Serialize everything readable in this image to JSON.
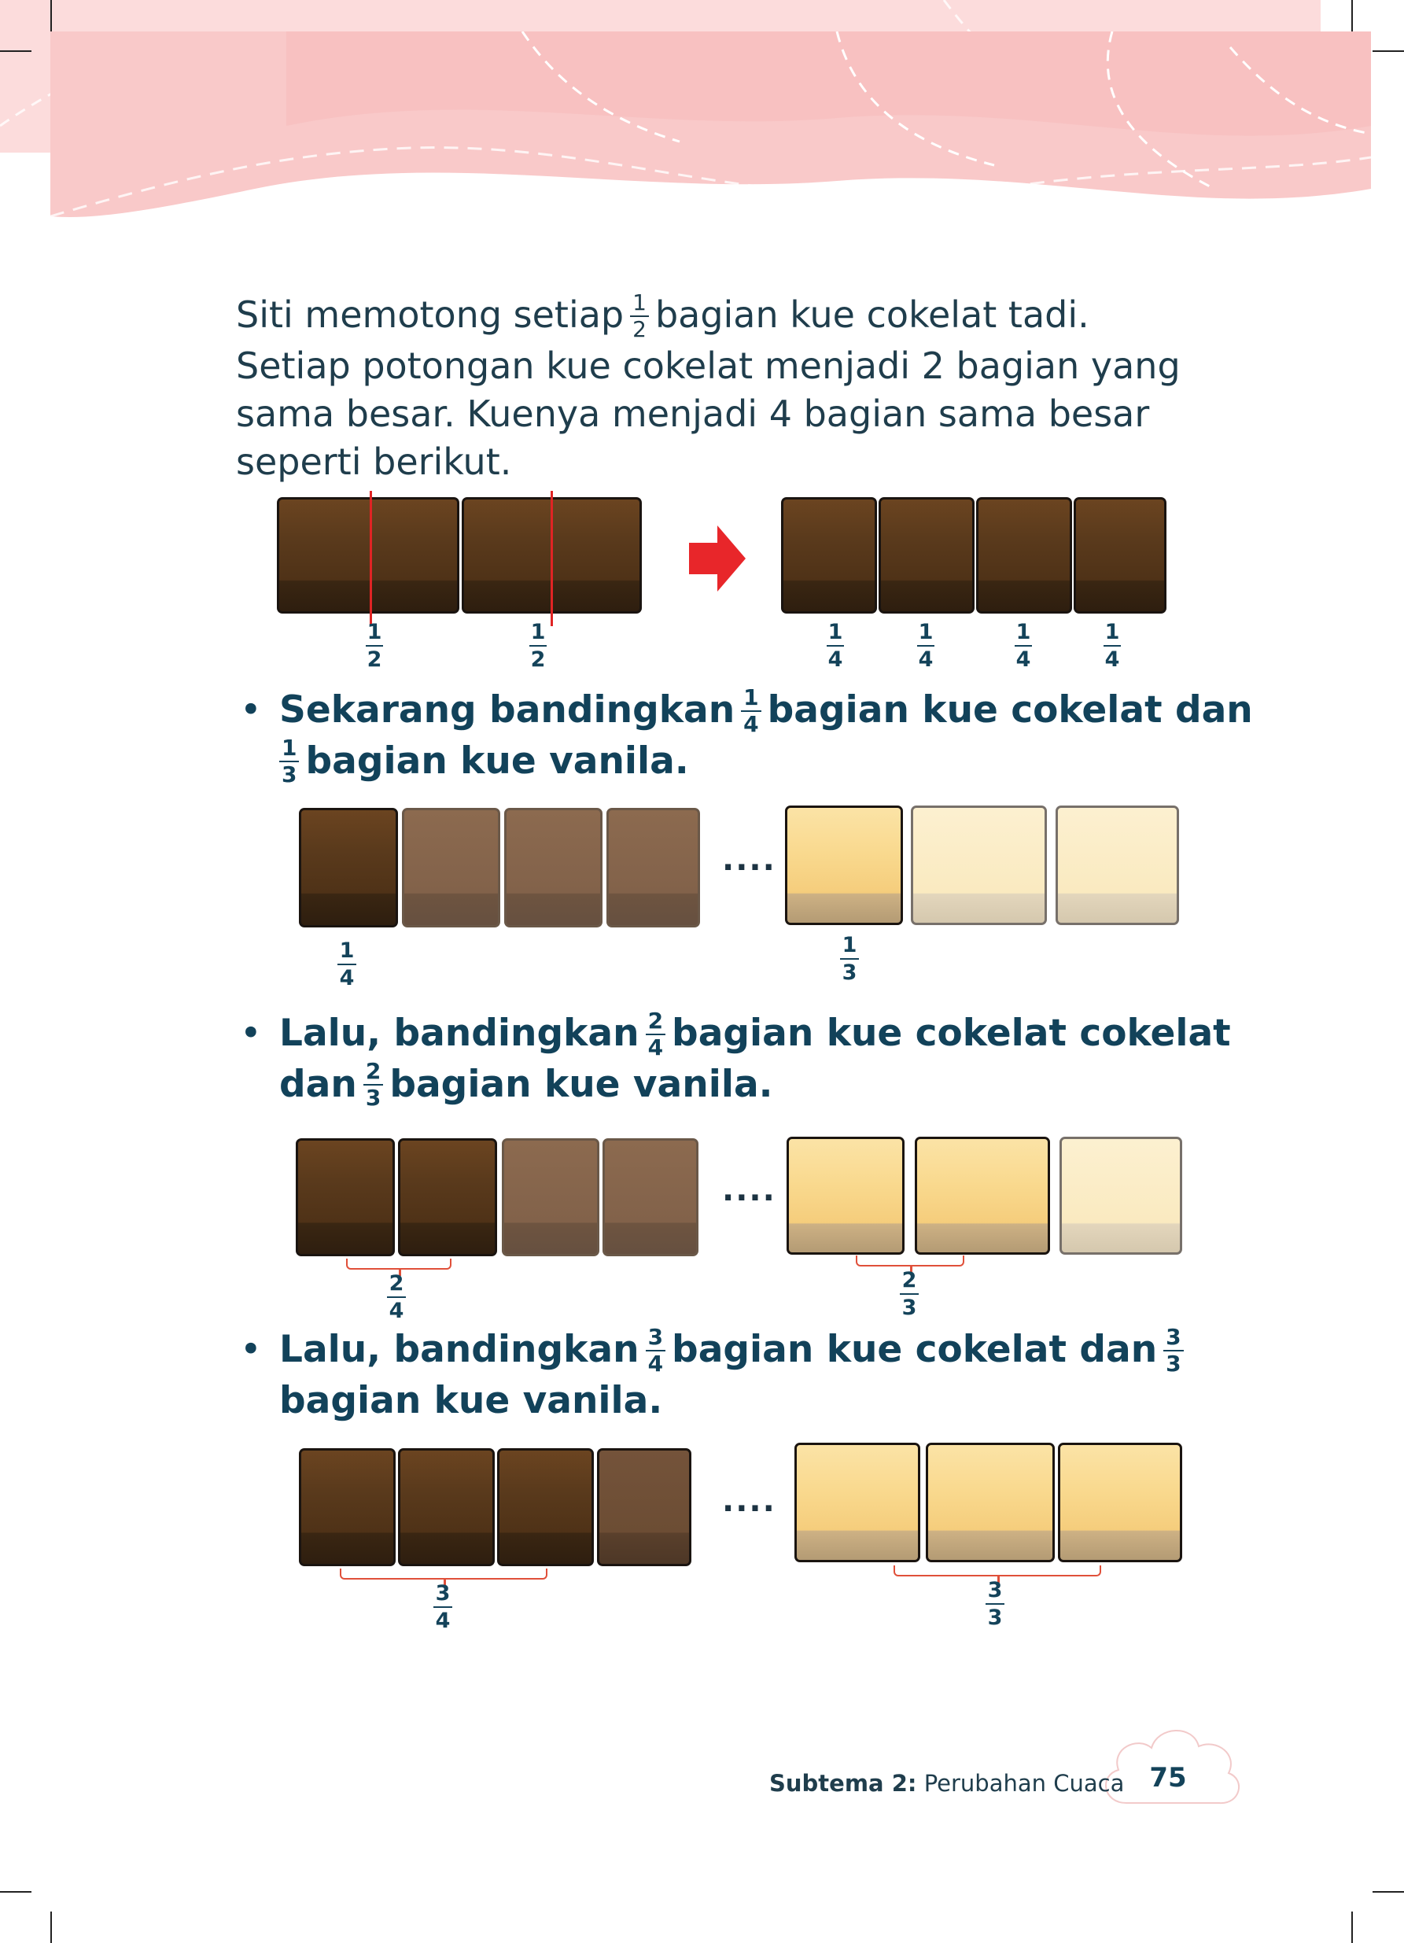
{
  "intro": {
    "line1_pre": "Siti memotong setiap",
    "line1_frac_n": "1",
    "line1_frac_d": "2",
    "line1_post": "bagian kue cokelat tadi.",
    "line2": "Setiap potongan kue cokelat menjadi 2 bagian yang",
    "line3": "sama besar. Kuenya menjadi 4 bagian sama besar",
    "line4": "seperti berikut."
  },
  "figure1": {
    "left_labels": [
      {
        "n": "1",
        "d": "2"
      },
      {
        "n": "1",
        "d": "2"
      }
    ],
    "right_labels": [
      {
        "n": "1",
        "d": "4"
      },
      {
        "n": "1",
        "d": "4"
      },
      {
        "n": "1",
        "d": "4"
      },
      {
        "n": "1",
        "d": "4"
      }
    ],
    "arrow_color": "#e8262a"
  },
  "bullets": [
    {
      "pre": "Sekarang bandingkan",
      "frac1": {
        "n": "1",
        "d": "4"
      },
      "mid": "bagian kue cokelat dan",
      "frac2": {
        "n": "1",
        "d": "3"
      },
      "post": "bagian kue vanila.",
      "choc_label": {
        "n": "1",
        "d": "4"
      },
      "van_label": {
        "n": "1",
        "d": "3"
      },
      "compare": "...."
    },
    {
      "pre": "Lalu, bandingkan",
      "frac1": {
        "n": "2",
        "d": "4"
      },
      "mid": "bagian kue cokelat cokelat",
      "line2_pre": "dan",
      "frac2": {
        "n": "2",
        "d": "3"
      },
      "post": "bagian kue vanila.",
      "choc_label": {
        "n": "2",
        "d": "4"
      },
      "van_label": {
        "n": "2",
        "d": "3"
      },
      "compare": "...."
    },
    {
      "pre": "Lalu, bandingkan",
      "frac1": {
        "n": "3",
        "d": "4"
      },
      "mid": "bagian kue cokelat dan",
      "frac2": {
        "n": "3",
        "d": "3"
      },
      "post": "bagian kue vanila.",
      "choc_label": {
        "n": "3",
        "d": "4"
      },
      "van_label": {
        "n": "3",
        "d": "3"
      },
      "compare": "...."
    }
  ],
  "footer": {
    "subtema_label": "Subtema 2:",
    "subtema_title": "Perubahan Cuaca",
    "page_number": "75"
  },
  "colors": {
    "header_pink": "#f9c9c9",
    "footer_pink": "#fcdcdc",
    "text_dark_teal": "#14435a",
    "cut_red": "#e02424"
  }
}
